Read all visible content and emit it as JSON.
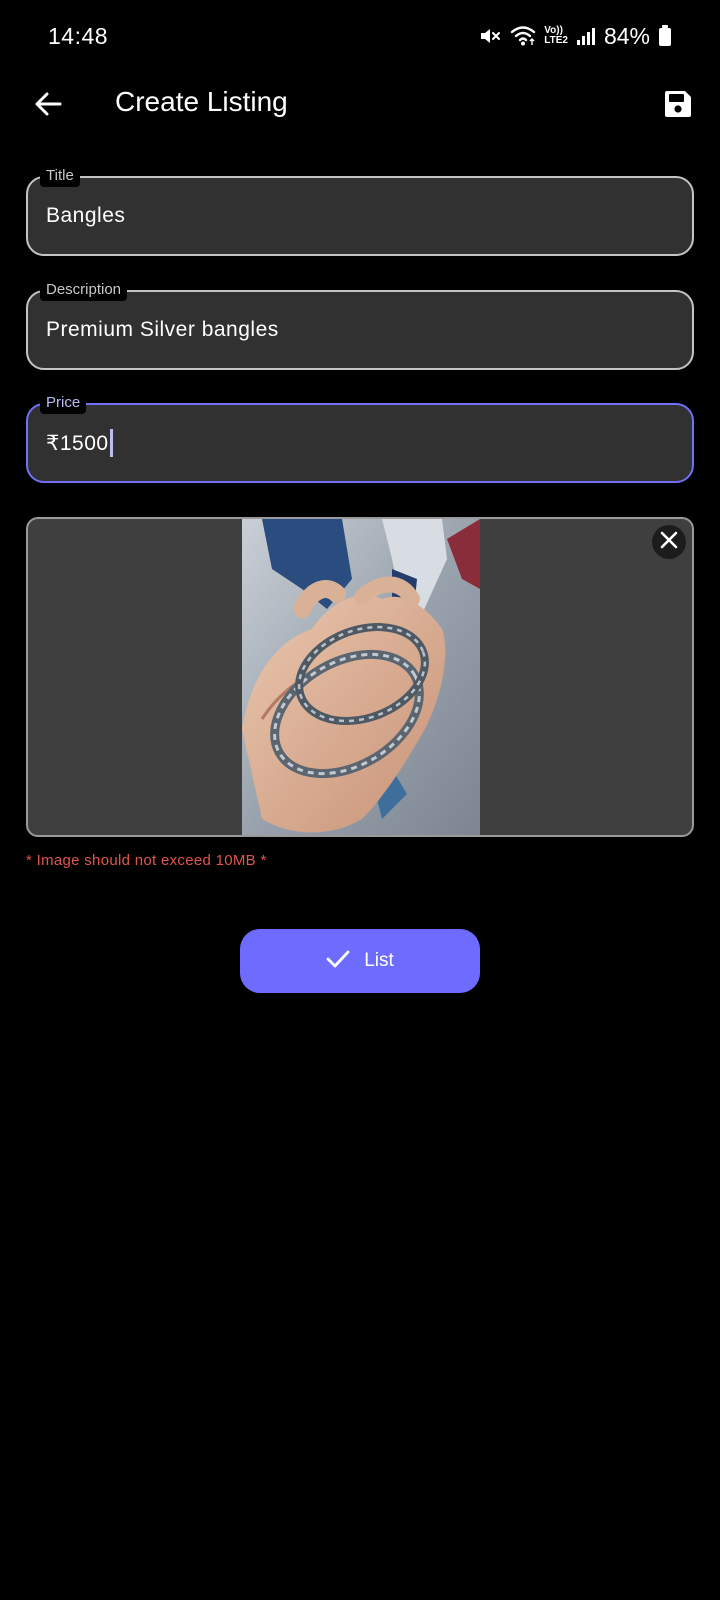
{
  "status_bar": {
    "time": "14:48",
    "battery_percent": "84%",
    "network_label_top": "Vo))",
    "network_label_bottom": "LTE2",
    "icons": [
      "mute-icon",
      "wifi-icon",
      "volte-icon",
      "signal-icon",
      "battery-icon"
    ]
  },
  "app_bar": {
    "title": "Create Listing",
    "back_icon": "arrow-back-icon",
    "save_icon": "save-icon"
  },
  "form": {
    "title_field": {
      "label": "Title",
      "value": "Bangles"
    },
    "description_field": {
      "label": "Description",
      "value": "Premium Silver bangles"
    },
    "price_field": {
      "label": "Price",
      "value": "₹1500",
      "focused": true
    }
  },
  "image_card": {
    "remove_icon": "close-icon"
  },
  "hint": "* Image should not exceed 10MB *",
  "list_button": {
    "label": "List",
    "icon": "check-icon"
  },
  "colors": {
    "background": "#000000",
    "field_fill": "#313131",
    "field_border": "#c4c4c4",
    "focus_accent": "#7370f5",
    "button": "#6e6cff",
    "error_text": "#e0554f"
  }
}
